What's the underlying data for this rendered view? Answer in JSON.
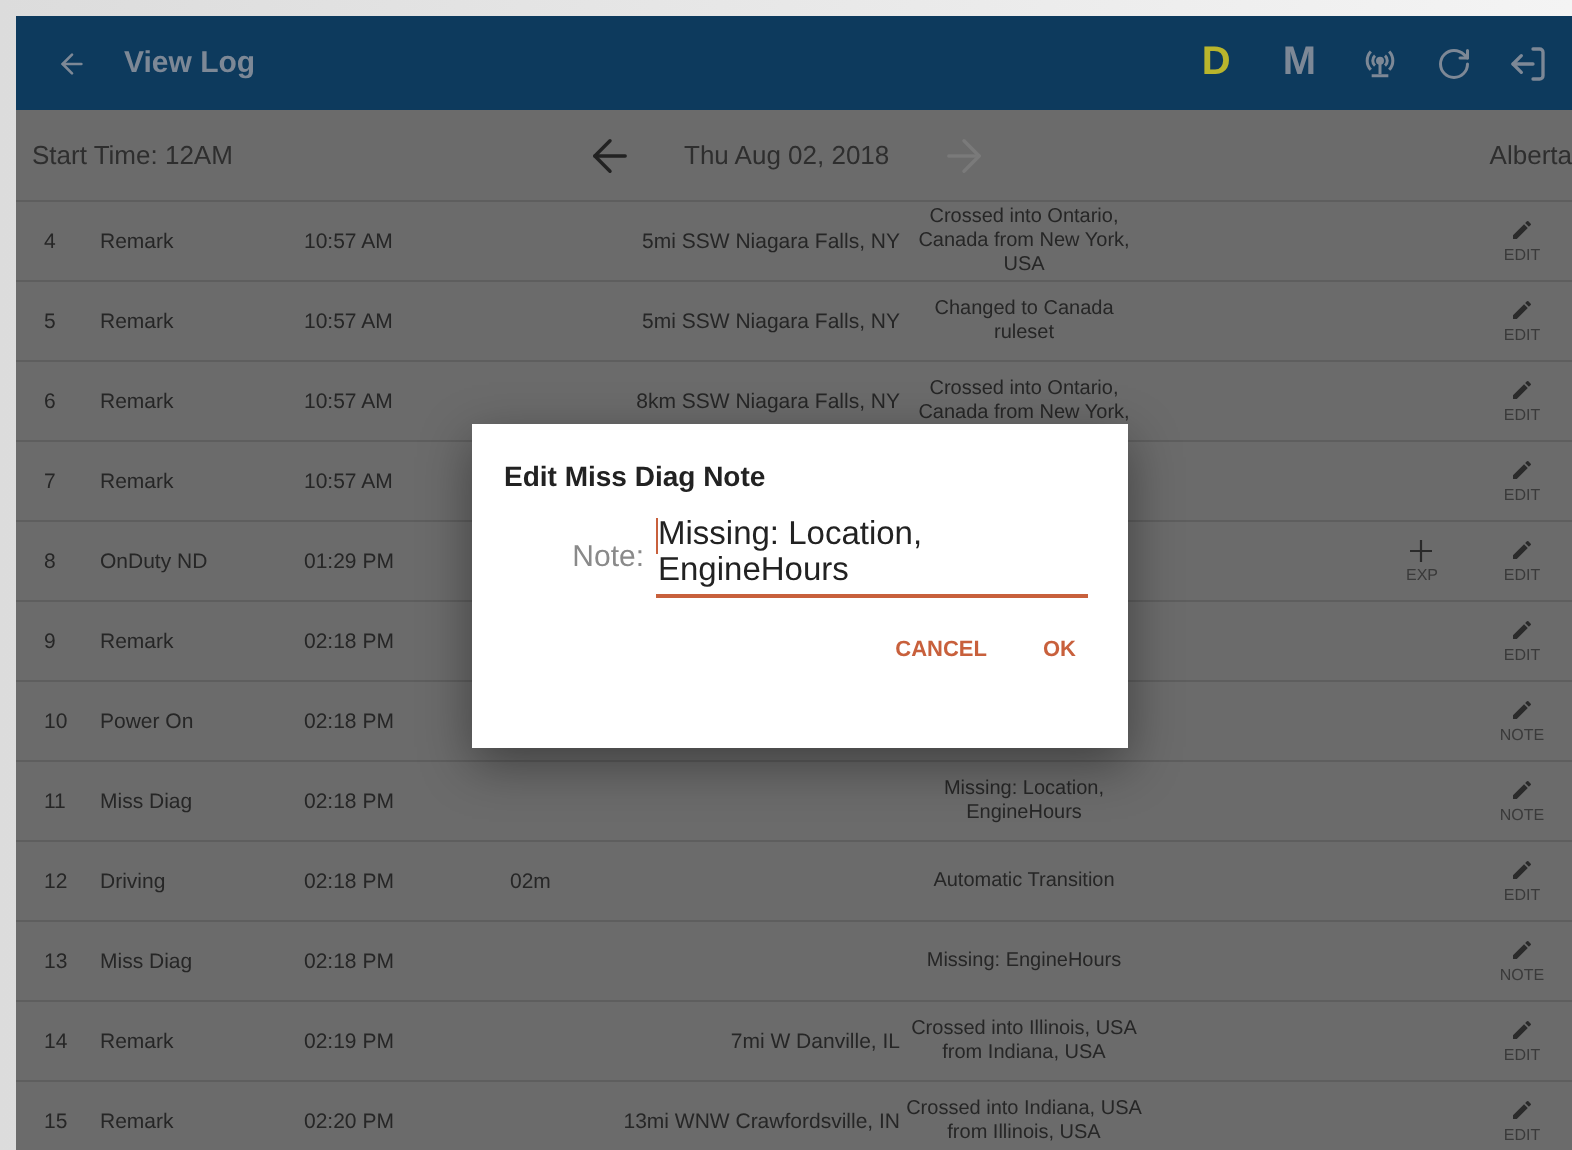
{
  "app_bar": {
    "title": "View Log",
    "status_letters": [
      {
        "label": "D",
        "color": "#b9b52c"
      },
      {
        "label": "M",
        "color": "#7d8896"
      }
    ]
  },
  "date_bar": {
    "start_time": "Start Time: 12AM",
    "date": "Thu Aug 02, 2018",
    "previous_disabled": false,
    "next_disabled": true,
    "region": "Alberta"
  },
  "rows": [
    {
      "number": "4",
      "event": "Remark",
      "time": "10:57 AM",
      "location": "5mi SSW Niagara Falls, NY",
      "note": "Crossed into Ontario, Canada from New York, USA",
      "action": "EDIT"
    },
    {
      "number": "5",
      "event": "Remark",
      "time": "10:57 AM",
      "location": "5mi SSW Niagara Falls, NY",
      "note": "Changed to Canada ruleset",
      "action": "EDIT"
    },
    {
      "number": "6",
      "event": "Remark",
      "time": "10:57 AM",
      "location": "8km SSW Niagara Falls, NY",
      "note": "Crossed into Ontario, Canada from New York,",
      "action": "EDIT"
    },
    {
      "number": "7",
      "event": "Remark",
      "time": "10:57 AM",
      "action": "EDIT"
    },
    {
      "number": "8",
      "event": "OnDuty ND",
      "time": "01:29 PM",
      "exp": "EXP",
      "action": "EDIT"
    },
    {
      "number": "9",
      "event": "Remark",
      "time": "02:18 PM",
      "action": "EDIT"
    },
    {
      "number": "10",
      "event": "Power On",
      "time": "02:18 PM",
      "action": "NOTE"
    },
    {
      "number": "11",
      "event": "Miss Diag",
      "time": "02:18 PM",
      "note": "Missing: Location, EngineHours",
      "action": "NOTE"
    },
    {
      "number": "12",
      "event": "Driving",
      "time": "02:18 PM",
      "duration": "02m",
      "note": "Automatic Transition",
      "action": "EDIT"
    },
    {
      "number": "13",
      "event": "Miss Diag",
      "time": "02:18 PM",
      "note": "Missing: EngineHours",
      "action": "NOTE"
    },
    {
      "number": "14",
      "event": "Remark",
      "time": "02:19 PM",
      "location": "7mi W Danville, IL",
      "note": "Crossed into Illinois, USA from Indiana, USA",
      "action": "EDIT"
    },
    {
      "number": "15",
      "event": "Remark",
      "time": "02:20 PM",
      "location": "13mi WNW Crawfordsville, IN",
      "note": "Crossed into Indiana, USA from Illinois, USA",
      "action": "EDIT"
    }
  ],
  "dialog": {
    "title": "Edit Miss Diag Note",
    "field_label": "Note:",
    "value": "Missing: Location, EngineHours",
    "buttons": [
      "CANCEL",
      "OK"
    ]
  }
}
